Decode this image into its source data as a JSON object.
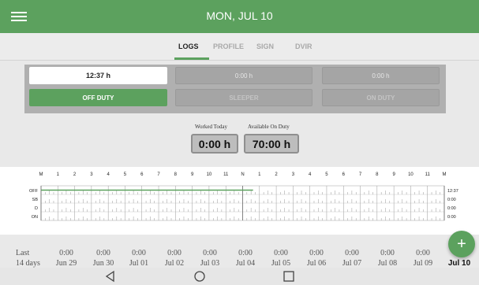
{
  "header": {
    "title": "MON, JUL 10"
  },
  "tabs": [
    {
      "label": "LOGS",
      "active": true
    },
    {
      "label": "PROFILE"
    },
    {
      "label": "SIGN"
    },
    {
      "label": "DVIR"
    }
  ],
  "status": {
    "times": [
      "12:37 h",
      "0:00 h",
      "0:00 h"
    ],
    "buttons": [
      "OFF DUTY",
      "SLEEPER",
      "ON DUTY"
    ]
  },
  "summary": {
    "worked_label": "Worked Today",
    "worked_value": "0:00 h",
    "available_label": "Available On Duty",
    "available_value": "70:00 h"
  },
  "log_grid": {
    "hour_labels": [
      "M",
      "1",
      "2",
      "3",
      "4",
      "5",
      "6",
      "7",
      "8",
      "9",
      "10",
      "11",
      "N",
      "1",
      "2",
      "3",
      "4",
      "5",
      "6",
      "7",
      "8",
      "9",
      "10",
      "11",
      "M"
    ],
    "rows": [
      "OFF",
      "SB",
      "D",
      "ON"
    ],
    "totals": [
      "12:37",
      "0:00",
      "0:00",
      "0:00"
    ],
    "off_duty_until_hour": 12.62
  },
  "days": [
    {
      "top": "Last",
      "bottom": "14 days"
    },
    {
      "top": "0:00",
      "bottom": "Jun 29"
    },
    {
      "top": "0:00",
      "bottom": "Jun 30"
    },
    {
      "top": "0:00",
      "bottom": "Jul 01"
    },
    {
      "top": "0:00",
      "bottom": "Jul 02"
    },
    {
      "top": "0:00",
      "bottom": "Jul 03"
    },
    {
      "top": "0:00",
      "bottom": "Jul 04"
    },
    {
      "top": "0:00",
      "bottom": "Jul 05"
    },
    {
      "top": "0:00",
      "bottom": "Jul 06"
    },
    {
      "top": "0:00",
      "bottom": "Jul 07"
    },
    {
      "top": "0:00",
      "bottom": "Jul 08"
    },
    {
      "top": "0:00",
      "bottom": "Jul 09"
    },
    {
      "top": "",
      "bottom": "Jul 10"
    }
  ],
  "fab": {
    "label": "+"
  },
  "colors": {
    "accent": "#5ca15e"
  },
  "icons": [
    "menu-icon",
    "back-icon",
    "home-icon",
    "recents-icon",
    "add-icon"
  ]
}
